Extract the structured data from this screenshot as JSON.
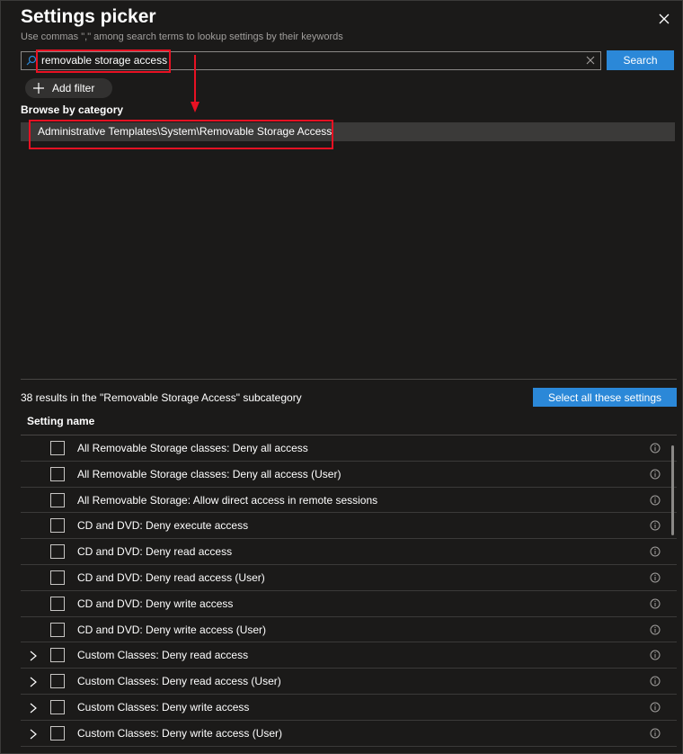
{
  "header": {
    "title": "Settings picker",
    "subtitle": "Use commas \",\" among search terms to lookup settings by their keywords"
  },
  "search": {
    "value": "removable storage access",
    "button_label": "Search"
  },
  "filter": {
    "add_label": "Add filter"
  },
  "browse": {
    "label": "Browse by category",
    "categories": [
      "Administrative Templates\\System\\Removable Storage Access"
    ]
  },
  "results": {
    "summary": "38 results in the \"Removable Storage Access\" subcategory",
    "select_all_label": "Select all these settings",
    "column_header": "Setting name",
    "rows": [
      {
        "label": "All Removable Storage classes: Deny all access",
        "expandable": false
      },
      {
        "label": "All Removable Storage classes: Deny all access (User)",
        "expandable": false
      },
      {
        "label": "All Removable Storage: Allow direct access in remote sessions",
        "expandable": false
      },
      {
        "label": "CD and DVD: Deny execute access",
        "expandable": false
      },
      {
        "label": "CD and DVD: Deny read access",
        "expandable": false
      },
      {
        "label": "CD and DVD: Deny read access (User)",
        "expandable": false
      },
      {
        "label": "CD and DVD: Deny write access",
        "expandable": false
      },
      {
        "label": "CD and DVD: Deny write access (User)",
        "expandable": false
      },
      {
        "label": "Custom Classes: Deny read access",
        "expandable": true
      },
      {
        "label": "Custom Classes: Deny read access (User)",
        "expandable": true
      },
      {
        "label": "Custom Classes: Deny write access",
        "expandable": true
      },
      {
        "label": "Custom Classes: Deny write access (User)",
        "expandable": true
      }
    ]
  },
  "colors": {
    "background": "#1b1a19",
    "accent": "#2b88d8",
    "highlight": "#e81123"
  },
  "icons": {
    "close": "close-icon",
    "search": "search-icon",
    "clear": "clear-icon",
    "plus": "plus-icon",
    "info": "info-icon",
    "chevron": "chevron-right-icon"
  }
}
